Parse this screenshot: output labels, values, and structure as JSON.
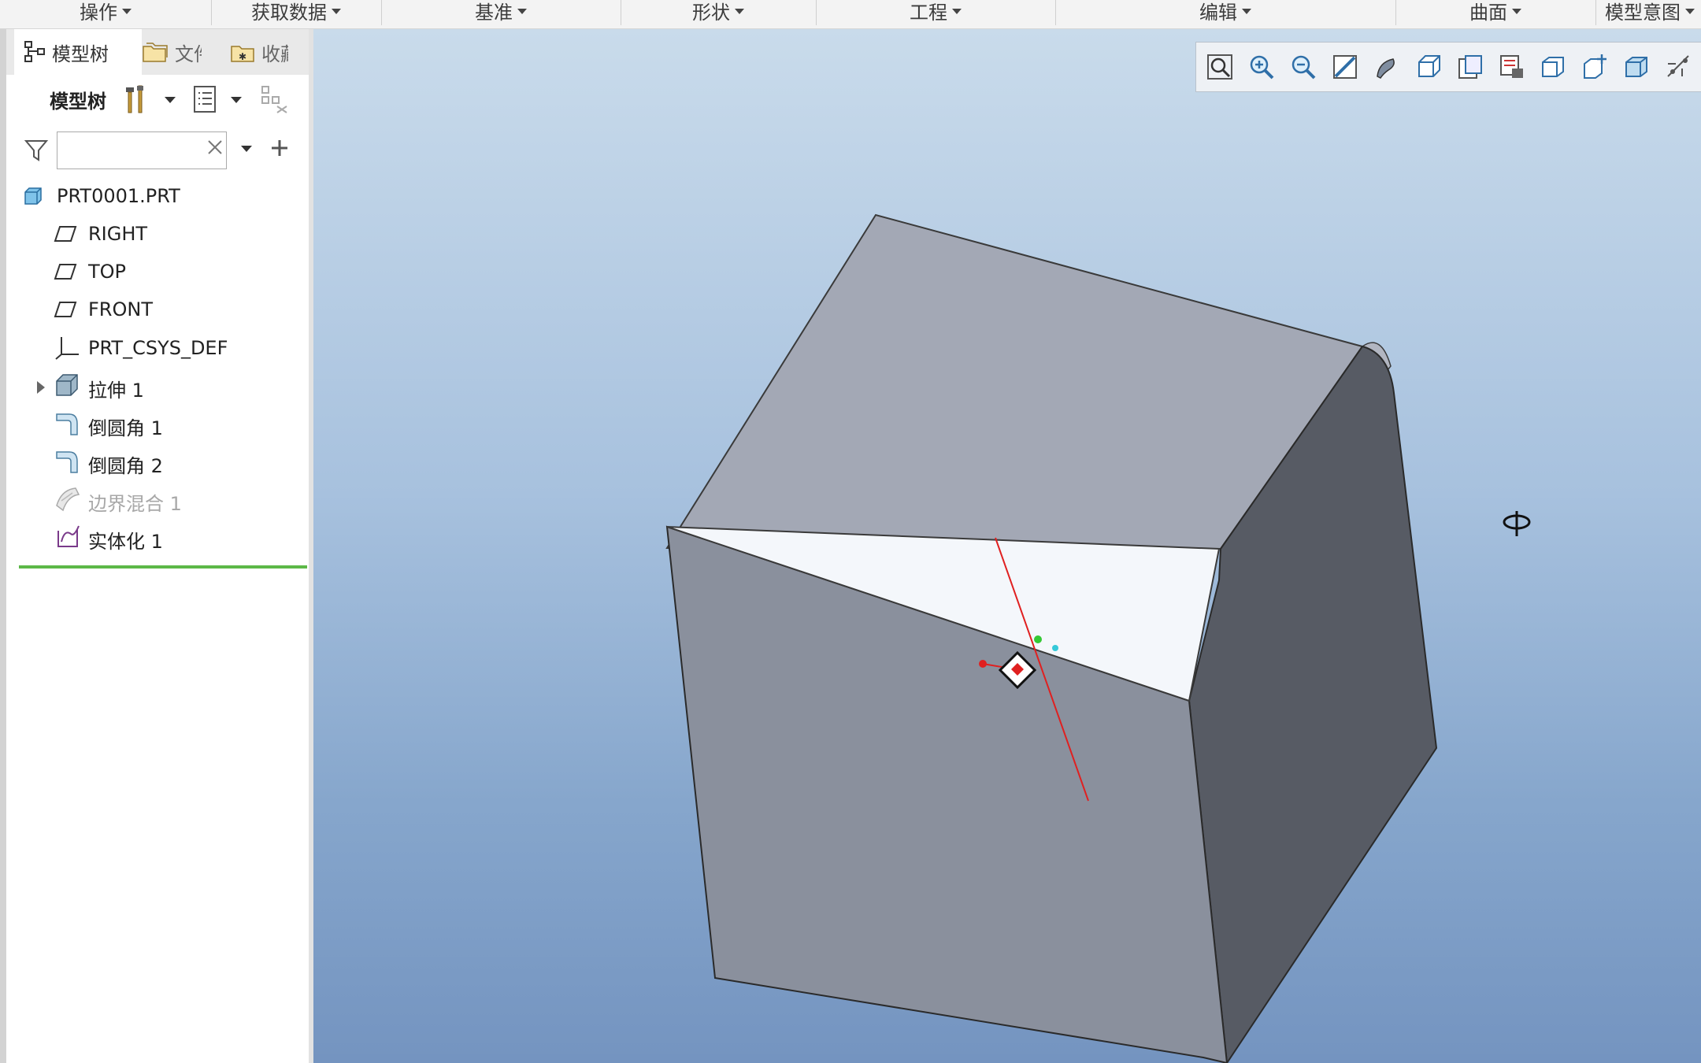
{
  "ribbon": {
    "groups": [
      {
        "label": "操作"
      },
      {
        "label": "获取数据"
      },
      {
        "label": "基准"
      },
      {
        "label": "形状"
      },
      {
        "label": "工程"
      },
      {
        "label": "编辑"
      },
      {
        "label": "曲面"
      },
      {
        "label": "模型意图"
      }
    ]
  },
  "panel": {
    "tabs": [
      {
        "label": "模型树",
        "icon": "model-tree-icon",
        "active": true
      },
      {
        "label": "文件",
        "icon": "folder-browser-icon",
        "active": false
      },
      {
        "label": "收藏",
        "icon": "favorites-icon",
        "active": false
      }
    ],
    "tree_header": "模型树",
    "search": {
      "value": "",
      "placeholder": ""
    },
    "items": [
      {
        "label": "PRT0001.PRT",
        "icon": "part-icon",
        "indent": 0,
        "expandable": false,
        "disabled": false
      },
      {
        "label": "RIGHT",
        "icon": "datum-plane-icon",
        "indent": 1,
        "expandable": false,
        "disabled": false
      },
      {
        "label": "TOP",
        "icon": "datum-plane-icon",
        "indent": 1,
        "expandable": false,
        "disabled": false
      },
      {
        "label": "FRONT",
        "icon": "datum-plane-icon",
        "indent": 1,
        "expandable": false,
        "disabled": false
      },
      {
        "label": "PRT_CSYS_DEF",
        "icon": "coordinate-system-icon",
        "indent": 1,
        "expandable": false,
        "disabled": false
      },
      {
        "label": "拉伸 1",
        "icon": "extrude-icon",
        "indent": 1,
        "expandable": true,
        "disabled": false
      },
      {
        "label": "倒圆角 1",
        "icon": "round-icon",
        "indent": 1,
        "expandable": false,
        "disabled": false
      },
      {
        "label": "倒圆角 2",
        "icon": "round-icon",
        "indent": 1,
        "expandable": false,
        "disabled": false
      },
      {
        "label": "边界混合 1",
        "icon": "boundary-blend-icon",
        "indent": 1,
        "expandable": false,
        "disabled": true
      },
      {
        "label": "实体化 1",
        "icon": "solidify-icon",
        "indent": 1,
        "expandable": false,
        "disabled": false
      }
    ]
  },
  "view_toolbar": {
    "icons": [
      "refit-icon",
      "zoom-in-icon",
      "zoom-out-icon",
      "repaint-icon",
      "display-style-icon",
      "saved-orientations-icon",
      "view-manager-icon",
      "perspective-view-icon",
      "spin-center-icon",
      "annotation-display-icon",
      "datum-display-icon",
      "datum-display-filters-icon"
    ]
  },
  "colors": {
    "viewport_top": "#c9dbeb",
    "viewport_bottom": "#7494c0",
    "insert_indicator": "#5cb847",
    "model_top_face": "#a3a8b5",
    "model_front_face": "#8a909d",
    "model_side_face": "#575b64",
    "model_surface_face": "#f4f7fb",
    "axis_red": "#e02020"
  }
}
